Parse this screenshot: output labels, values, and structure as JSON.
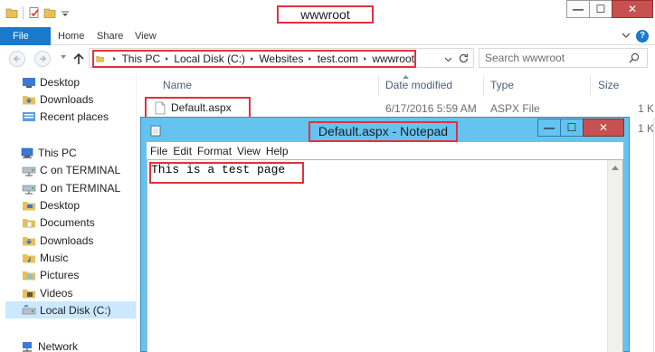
{
  "explorer": {
    "title": "wwwroot",
    "window_buttons": {
      "minimize": "—",
      "maximize": "☐",
      "close": "✕"
    },
    "ribbon": {
      "file_tab": "File",
      "tabs": [
        "Home",
        "Share",
        "View"
      ],
      "help_label": "?"
    },
    "address": {
      "crumbs": [
        "This PC",
        "Local Disk (C:)",
        "Websites",
        "test.com",
        "wwwroot"
      ]
    },
    "search": {
      "placeholder": "Search wwwroot"
    },
    "nav_pane": {
      "items": [
        {
          "label": "Desktop",
          "icon": "desktop-icon"
        },
        {
          "label": "Downloads",
          "icon": "downloads-icon"
        },
        {
          "label": "Recent places",
          "icon": "recent-places-icon"
        },
        {
          "label": "This PC",
          "icon": "this-pc-icon"
        },
        {
          "label": "C on TERMINAL",
          "icon": "network-drive-icon"
        },
        {
          "label": "D on TERMINAL",
          "icon": "network-drive-icon"
        },
        {
          "label": "Desktop",
          "icon": "desktop-icon"
        },
        {
          "label": "Documents",
          "icon": "documents-icon"
        },
        {
          "label": "Downloads",
          "icon": "downloads-icon"
        },
        {
          "label": "Music",
          "icon": "music-icon"
        },
        {
          "label": "Pictures",
          "icon": "pictures-icon"
        },
        {
          "label": "Videos",
          "icon": "videos-icon"
        },
        {
          "label": "Local Disk (C:)",
          "icon": "local-disk-icon"
        },
        {
          "label": "Network",
          "icon": "network-icon"
        }
      ]
    },
    "file_list": {
      "columns": {
        "name": "Name",
        "date": "Date modified",
        "type": "Type",
        "size": "Size"
      },
      "rows": [
        {
          "name": "Default.aspx",
          "date": "6/17/2016 5:59 AM",
          "type": "ASPX File",
          "size": "1 K"
        }
      ],
      "partial_size_values": [
        "1 K",
        "1 K"
      ]
    }
  },
  "notepad": {
    "title": "Default.aspx - Notepad",
    "menu": [
      "File",
      "Edit",
      "Format",
      "View",
      "Help"
    ],
    "content": "This is a test page",
    "window_buttons": {
      "minimize": "—",
      "maximize": "☐",
      "close": "✕"
    }
  },
  "colors": {
    "annotation_red": "#e2313b",
    "ribbon_blue": "#1979ca",
    "notepad_frame": "#65c3f0",
    "close_button": "#c75050",
    "selected_item": "#cce8ff"
  }
}
